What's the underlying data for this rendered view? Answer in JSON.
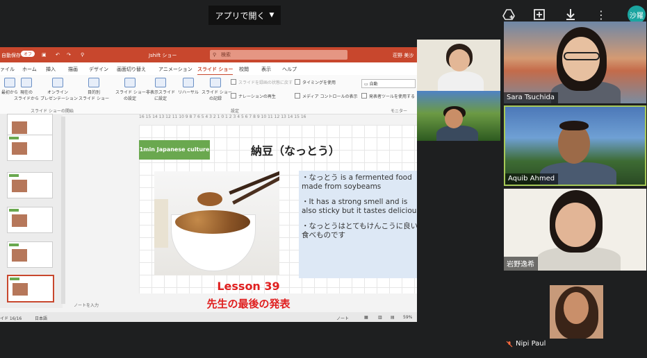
{
  "topbar": {
    "open_with_label": "アプリで開く",
    "avatar_initials": "沙羅",
    "icons": [
      "add-to-drive-icon",
      "new-window-icon",
      "download-icon",
      "more-vert-icon"
    ]
  },
  "ppt": {
    "title_left": "自動保存",
    "title_toggle": "オフ",
    "file_name": "Jshift ショー",
    "search_placeholder": "検索",
    "user_name": "荘野 美沙",
    "tabs": [
      "ァイル",
      "ホーム",
      "挿入",
      "描画",
      "デザイン",
      "画面切り替え",
      "アニメーション",
      "スライド ショー",
      "校閲",
      "表示",
      "ヘルプ"
    ],
    "active_tab": "スライド ショー",
    "ribbon": {
      "btn_from_start": "最初から",
      "btn_from_current": "現在の\nスライドから",
      "btn_online": "オンライン\nプレゼンテーション",
      "btn_custom": "目的別\nスライド ショー",
      "btn_setup": "スライド ショー\nの設定",
      "btn_hide": "非表示スライド\nに設定",
      "btn_rehearse": "リハーサル",
      "btn_record": "スライド ショー\nの記録",
      "chk_narration": "ナレーションの再生",
      "chk_timing": "タイミングを使用",
      "chk_media": "メディア コントロールの表示",
      "chk_recording_note": "スライドを録画の状態に戻す",
      "monitor_value": "自動",
      "chk_presenter": "発表者ツールを使用する",
      "group_start": "スライド ショーの開始",
      "group_setup": "設定",
      "group_monitor": "モニター"
    },
    "ruler_top": "16 15 14 13 12 11 10 9 8 7 6 5 4 3 2 1 0 1 2 3 4 5 6 7 8 9 10 11 12 13 14 15 16",
    "notes_placeholder": "ノートを入力",
    "status_slide": "イド 16/16",
    "status_lang": "日本語",
    "status_notes": "ノート",
    "status_zoom": "59%"
  },
  "slide": {
    "badge": "1min Japanese culture",
    "title": "納豆（なっとう）",
    "bullets": [
      "・なっとう is a fermented food made from soybeams",
      "・It has a strong smell and is also sticky but it tastes delicious",
      "・なっとうはとてもけんこうに良い食べものです"
    ]
  },
  "overlay": {
    "lesson": "Lesson 39",
    "presentation": "先生の最後の発表"
  },
  "participants": {
    "sara": "Sara Tsuchida",
    "aquib": "Aquib Ahmed",
    "iwano": "岩野逸希",
    "nipi": "Nipi Paul"
  },
  "colors": {
    "ppt_accent": "#c8472d",
    "badge_green": "#6aa84f",
    "overlay_red": "#e02020",
    "speaking_border": "#a7c957"
  }
}
